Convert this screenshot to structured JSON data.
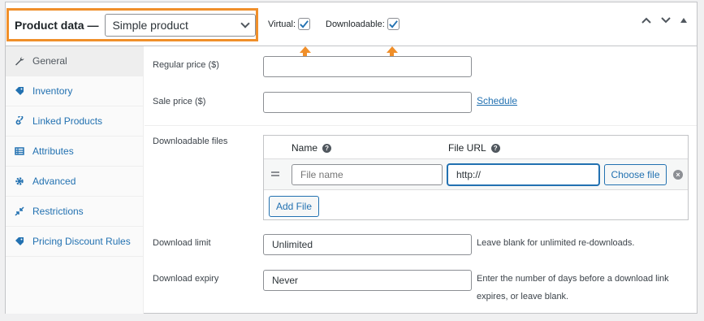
{
  "header": {
    "product_data_label": "Product data —",
    "product_type_value": "Simple product",
    "virtual_label": "Virtual:",
    "virtual_checked": true,
    "downloadable_label": "Downloadable:",
    "downloadable_checked": true,
    "highlight_color": "#f08f2a",
    "icons": [
      "chevron-up-icon",
      "chevron-down-icon",
      "triangle-up-icon"
    ]
  },
  "sidebar": {
    "items": [
      {
        "label": "General",
        "icon": "wrench-icon",
        "active": true
      },
      {
        "label": "Inventory",
        "icon": "tag-icon",
        "active": false
      },
      {
        "label": "Linked Products",
        "icon": "link-icon",
        "active": false
      },
      {
        "label": "Attributes",
        "icon": "table-icon",
        "active": false
      },
      {
        "label": "Advanced",
        "icon": "gear-icon",
        "active": false
      },
      {
        "label": "Restrictions",
        "icon": "shrink-icon",
        "active": false
      },
      {
        "label": "Pricing Discount Rules",
        "icon": "tag-icon",
        "active": false
      }
    ]
  },
  "general": {
    "regular_price_label": "Regular price ($)",
    "regular_price_value": "",
    "sale_price_label": "Sale price ($)",
    "sale_price_value": "",
    "schedule_link": "Schedule",
    "downloadable_files_label": "Downloadable files",
    "files_table": {
      "col_name": "Name",
      "col_url": "File URL",
      "row": {
        "name_placeholder": "File name",
        "url_value": "http://",
        "choose_file_label": "Choose file"
      },
      "add_file_label": "Add File"
    },
    "download_limit_label": "Download limit",
    "download_limit_value": "Unlimited",
    "download_limit_desc": "Leave blank for unlimited re-downloads.",
    "download_expiry_label": "Download expiry",
    "download_expiry_value": "Never",
    "download_expiry_desc": "Enter the number of days before a download link expires, or leave blank."
  }
}
